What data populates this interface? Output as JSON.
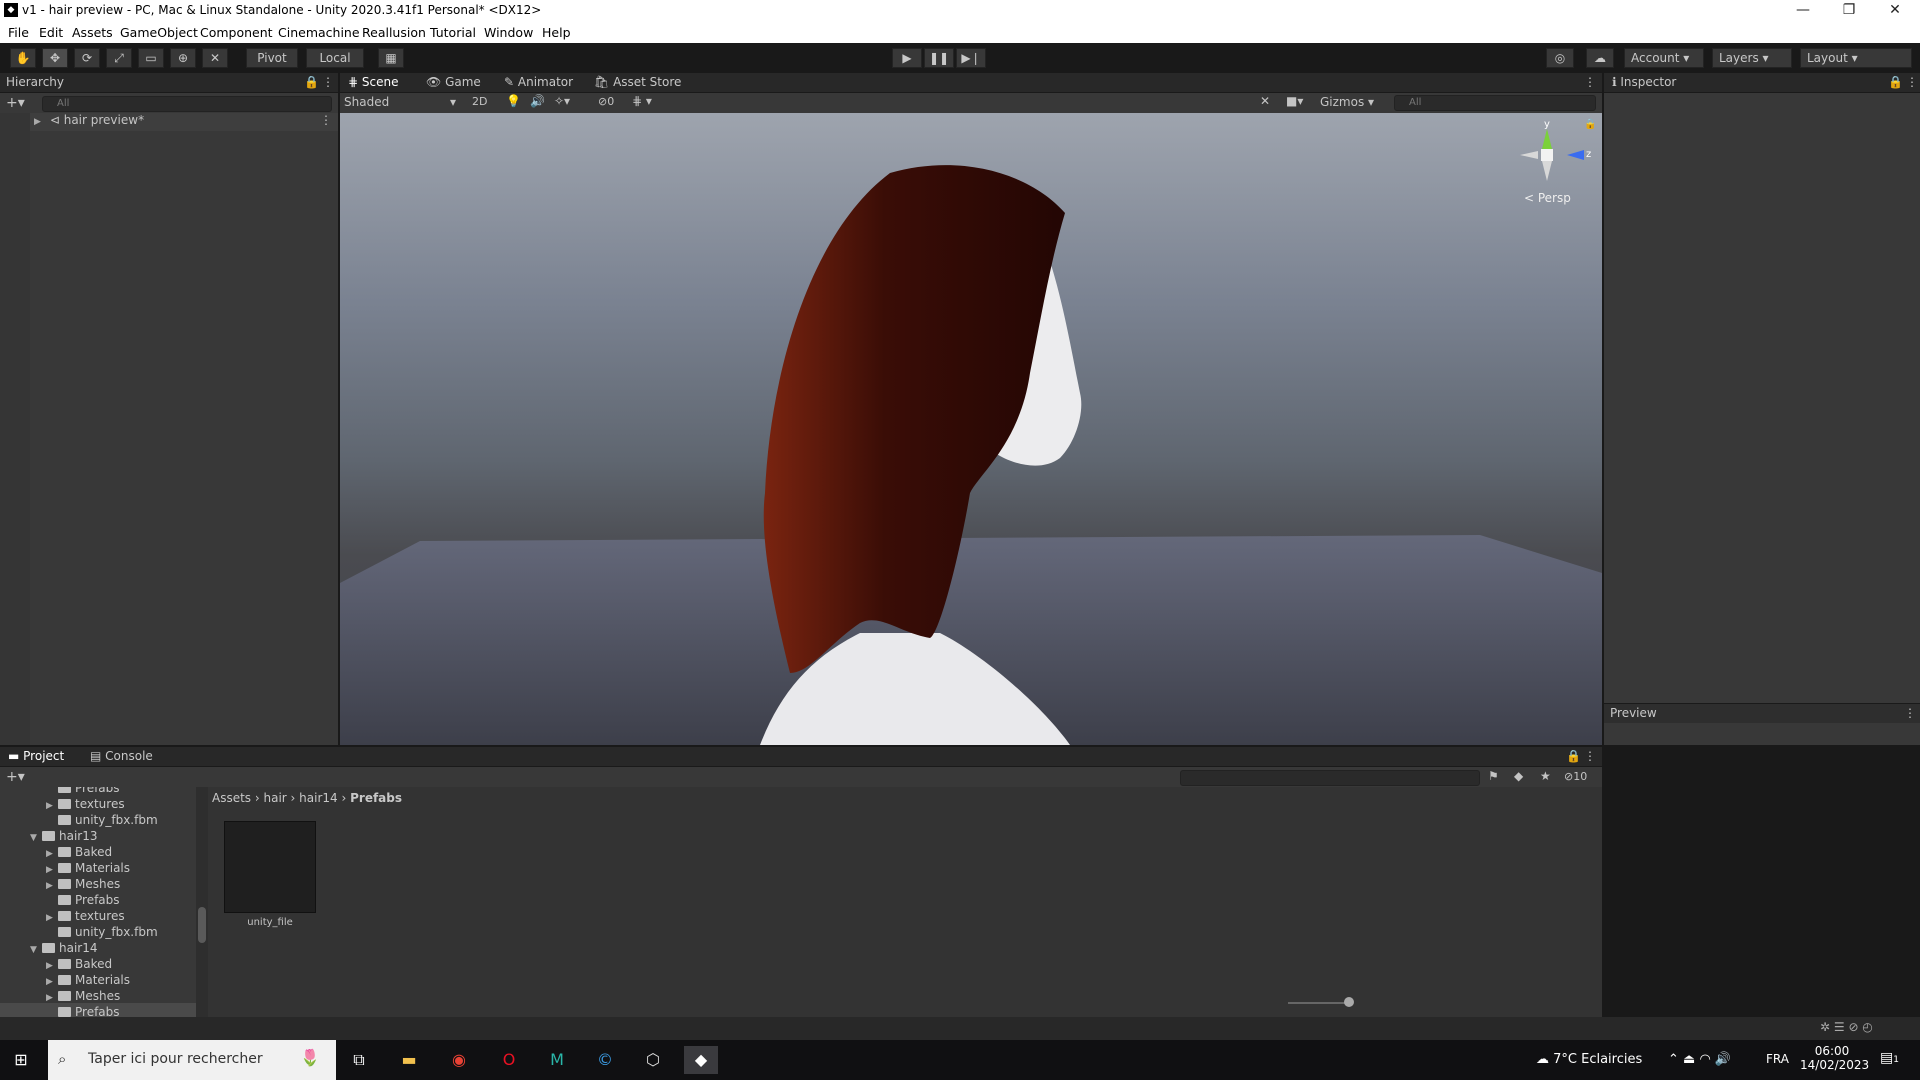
{
  "window": {
    "title": "v1 - hair preview - PC, Mac & Linux Standalone - Unity 2020.3.41f1 Personal* <DX12>"
  },
  "menu": [
    "File",
    "Edit",
    "Assets",
    "GameObject",
    "Component",
    "Cinemachine",
    "Reallusion",
    "Tutorial",
    "Window",
    "Help"
  ],
  "toolbar": {
    "pivot": "Pivot",
    "local": "Local",
    "account": "Account",
    "layers": "Layers",
    "layout": "Layout"
  },
  "hierarchy": {
    "tab": "Hierarchy",
    "search_placeholder": "All",
    "root_item": "hair preview*"
  },
  "scene_tabs": [
    "Scene",
    "Game",
    "Animator",
    "Asset Store"
  ],
  "scene_bar": {
    "shading": "Shaded",
    "mode2d": "2D",
    "hidden_count": "0",
    "gizmos": "Gizmos",
    "search_placeholder": "All"
  },
  "gizmo": {
    "y": "y",
    "z": "z",
    "persp": "< Persp"
  },
  "inspector": {
    "tab": "Inspector",
    "preview": "Preview"
  },
  "project": {
    "tabs": [
      "Project",
      "Console"
    ],
    "hidden_count": "10",
    "breadcrumb": [
      "Assets",
      "hair",
      "hair14",
      "Prefabs"
    ],
    "tree": [
      {
        "label": "Prefabs",
        "indent": 2,
        "arrow": ""
      },
      {
        "label": "textures",
        "indent": 2,
        "arrow": "▶"
      },
      {
        "label": "unity_fbx.fbm",
        "indent": 2,
        "arrow": ""
      },
      {
        "label": "hair13",
        "indent": 1,
        "arrow": "▼"
      },
      {
        "label": "Baked",
        "indent": 2,
        "arrow": "▶"
      },
      {
        "label": "Materials",
        "indent": 2,
        "arrow": "▶"
      },
      {
        "label": "Meshes",
        "indent": 2,
        "arrow": "▶"
      },
      {
        "label": "Prefabs",
        "indent": 2,
        "arrow": ""
      },
      {
        "label": "textures",
        "indent": 2,
        "arrow": "▶"
      },
      {
        "label": "unity_fbx.fbm",
        "indent": 2,
        "arrow": ""
      },
      {
        "label": "hair14",
        "indent": 1,
        "arrow": "▼"
      },
      {
        "label": "Baked",
        "indent": 2,
        "arrow": "▶"
      },
      {
        "label": "Materials",
        "indent": 2,
        "arrow": "▶"
      },
      {
        "label": "Meshes",
        "indent": 2,
        "arrow": "▶"
      },
      {
        "label": "Prefabs",
        "indent": 2,
        "arrow": "",
        "selected": true
      }
    ],
    "asset": {
      "name": "unity_file"
    }
  },
  "taskbar": {
    "search_placeholder": "Taper ici pour rechercher",
    "weather": "7°C  Eclaircies",
    "lang": "FRA",
    "time": "06:00",
    "date": "14/02/2023",
    "notif": "1"
  }
}
